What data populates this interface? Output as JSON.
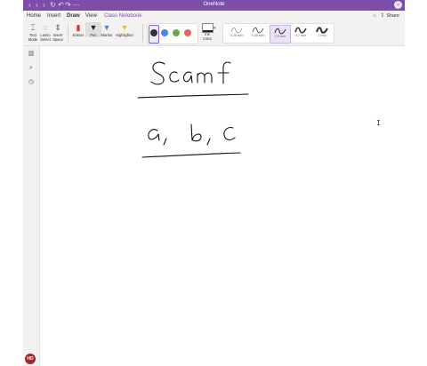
{
  "window": {
    "title": "OneNote",
    "user_initials": "HD"
  },
  "menu": {
    "tabs": [
      {
        "label": "Home"
      },
      {
        "label": "Insert"
      },
      {
        "label": "Draw"
      },
      {
        "label": "View"
      },
      {
        "label": "Class Notebook"
      }
    ],
    "active_tab": "Draw",
    "share_label": "Share"
  },
  "ribbon": {
    "tools": [
      {
        "label": "Text Mode"
      },
      {
        "label": "Lasso Select"
      },
      {
        "label": "Insert Space"
      },
      {
        "label": "Eraser"
      },
      {
        "label": "Pen"
      },
      {
        "label": "Marker"
      },
      {
        "label": "Highlighter"
      }
    ],
    "swatches": [
      "#333333",
      "#4a86e8",
      "#6aa84f",
      "#e06666"
    ],
    "ink_color_label": "Ink Color",
    "thickness": [
      {
        "label": "0.25 mm"
      },
      {
        "label": "0.35 mm"
      },
      {
        "label": "0.5 mm"
      },
      {
        "label": "0.7 mm"
      },
      {
        "label": "1 mm"
      }
    ]
  },
  "colors": {
    "accent": "#7b4fa8",
    "ink": "#111111"
  }
}
